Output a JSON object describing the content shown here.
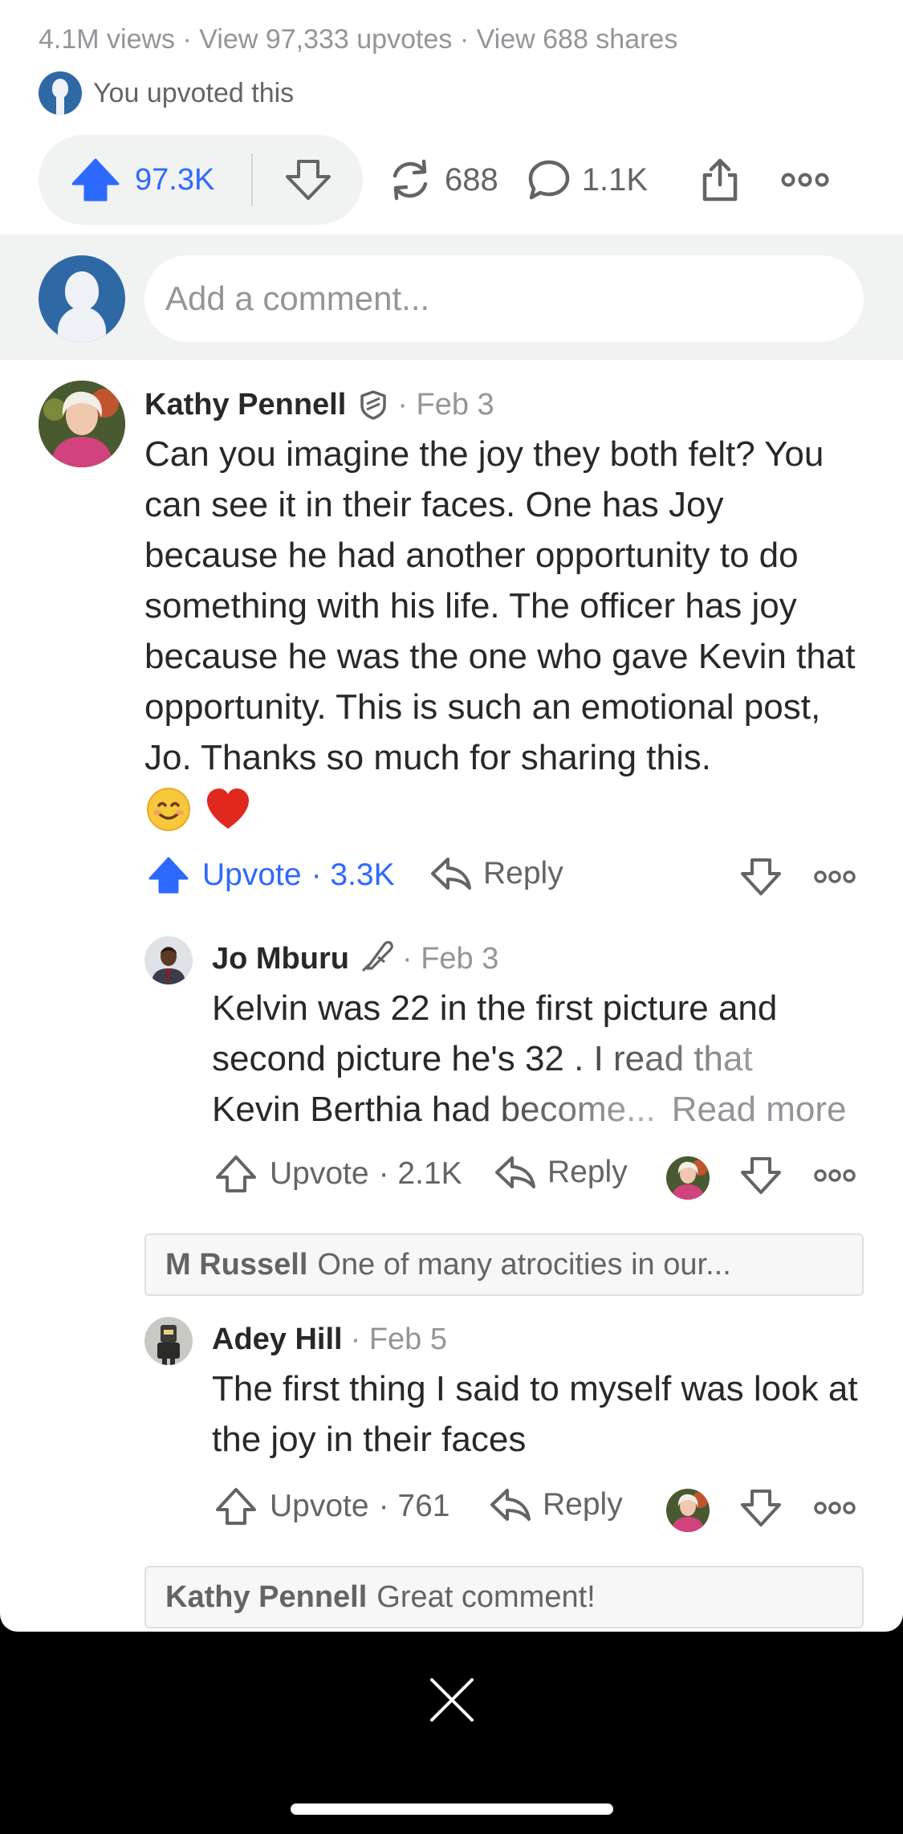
{
  "stats": {
    "views": "4.1M views",
    "upvotes_link": "View 97,333 upvotes",
    "shares_link": "View 688 shares",
    "sep": "·"
  },
  "upvoted_text": "You upvoted this",
  "actions": {
    "upvote_count": "97.3K",
    "reshare_count": "688",
    "comment_count": "1.1K"
  },
  "composer": {
    "placeholder": "Add a comment..."
  },
  "comments": [
    {
      "author": "Kathy Pennell",
      "date": "· Feb 3",
      "text": "Can you imagine the joy they both felt? You can see it in their faces. One has Joy because he had another opportunity to do something with his life. The officer has joy because he was the one who gave Kevin that opportunity. This is such an emotional post, Jo. Thanks so much for sharing this.",
      "emojis": "😊❤️",
      "upvote_label": "Upvote",
      "upvote_count": "· 3.3K",
      "reply_label": "Reply"
    },
    {
      "author": "Jo Mburu",
      "date": "· Feb 3",
      "text_line1": "Kelvin was 22 in the first picture and",
      "text_line2": "second picture he's 32 . I read that",
      "text_line3": "Kevin Berthia had become...",
      "read_more": "Read more",
      "upvote_label": "Upvote",
      "upvote_count": "· 2.1K",
      "reply_label": "Reply"
    },
    {
      "author": "Adey Hill",
      "date": "· Feb 5",
      "text": "The first thing I said to myself was look at the joy in their faces",
      "upvote_label": "Upvote",
      "upvote_count": "· 761",
      "reply_label": "Reply"
    }
  ],
  "quoted_replies": [
    {
      "author": "M Russell",
      "text": "One of many atrocities in our..."
    },
    {
      "author": "Kathy Pennell",
      "text": "Great comment!"
    }
  ],
  "colors": {
    "accent": "#2e69ff",
    "muted": "#939598",
    "avatar_blue": "#2e69a6"
  }
}
